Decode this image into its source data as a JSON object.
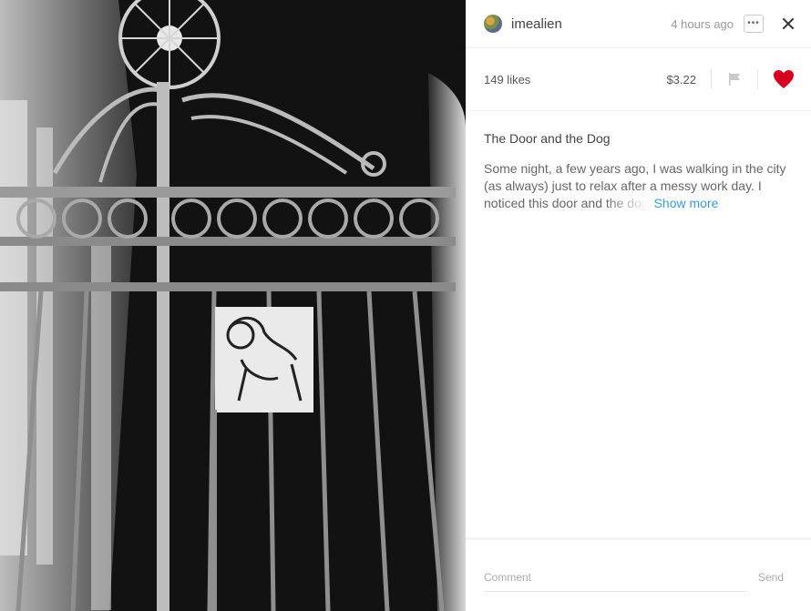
{
  "photo": {
    "alt_icon": "photo-dog-gate"
  },
  "header": {
    "username": "imealien",
    "time": "4 hours ago",
    "more_icon": "more-dots-icon",
    "close_icon": "close-icon"
  },
  "stats": {
    "likes": "149 likes",
    "price": "$3.22",
    "flag_icon": "flag-icon",
    "heart_icon": "heart-icon",
    "heart_color": "#d8001f"
  },
  "post": {
    "title": "The Door and the Dog",
    "description": "Some night, a few years ago, I was walking in the city (as always) just to relax after a messy work day. I noticed this door and",
    "description_faded": "the dog",
    "show_more": "Show more"
  },
  "footer": {
    "comment_placeholder": "Comment",
    "send_label": "Send"
  },
  "colors": {
    "accent_link": "#3b9bd6",
    "photo_bg": "#0d0d0d"
  }
}
